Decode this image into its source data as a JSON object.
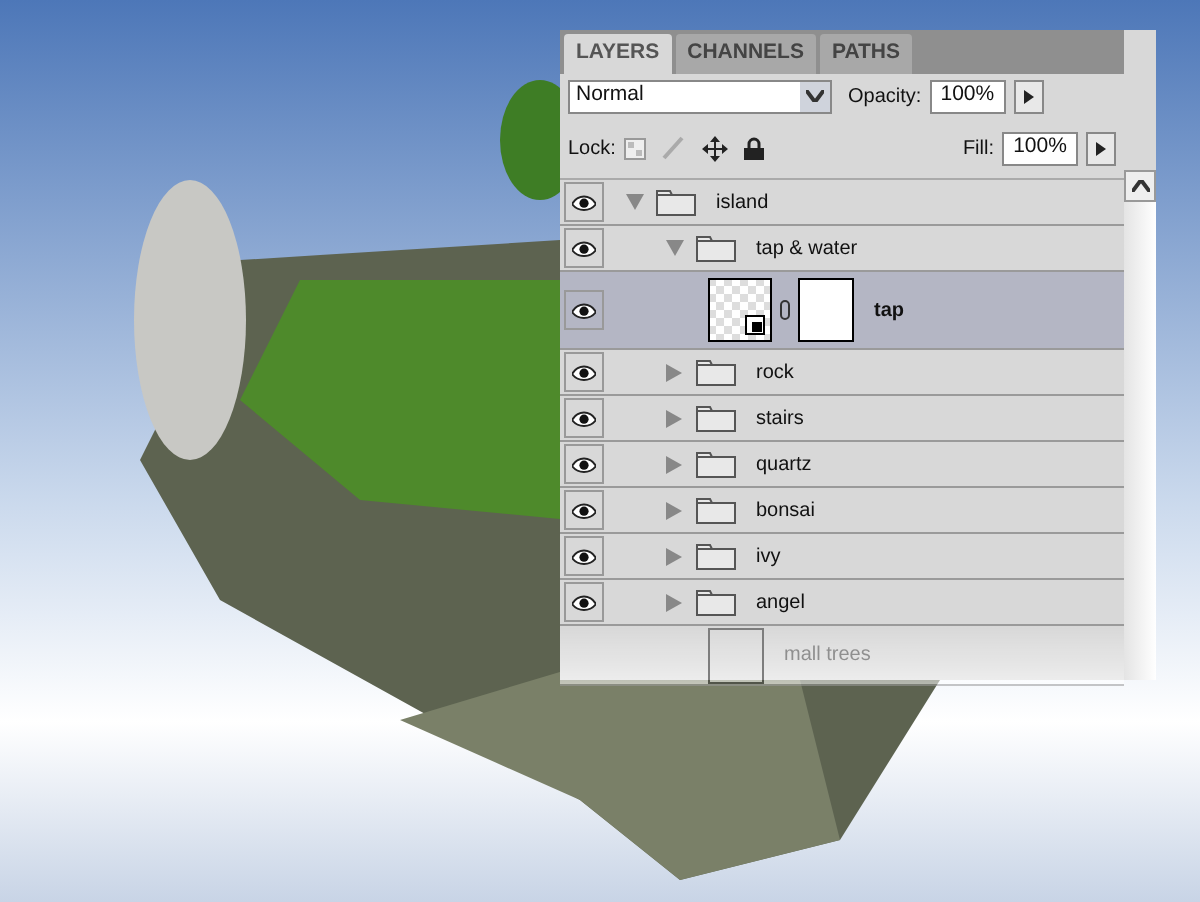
{
  "layers_panel": {
    "tabs": [
      {
        "label": "LAYERS",
        "selected": true
      },
      {
        "label": "CHANNELS",
        "selected": false
      },
      {
        "label": "PATHS",
        "selected": false
      }
    ],
    "blend_mode": {
      "value": "Normal"
    },
    "opacity": {
      "label": "Opacity:",
      "value": "100%"
    },
    "lock": {
      "label": "Lock:"
    },
    "fill": {
      "label": "Fill:",
      "value": "100%"
    },
    "layers": [
      {
        "name": "island",
        "kind": "group",
        "visible": true,
        "expanded": true,
        "selected": false,
        "children": [
          {
            "name": "tap & water",
            "kind": "group",
            "visible": true,
            "expanded": true,
            "selected": false,
            "children": [
              {
                "name": "tap",
                "kind": "layer",
                "visible": true,
                "selected": true
              }
            ]
          },
          {
            "name": "rock",
            "kind": "group",
            "visible": true,
            "expanded": false,
            "selected": false
          },
          {
            "name": "stairs",
            "kind": "group",
            "visible": true,
            "expanded": false,
            "selected": false
          },
          {
            "name": "quartz",
            "kind": "group",
            "visible": true,
            "expanded": false,
            "selected": false
          },
          {
            "name": "bonsai",
            "kind": "group",
            "visible": true,
            "expanded": false,
            "selected": false
          },
          {
            "name": "ivy",
            "kind": "group",
            "visible": true,
            "expanded": false,
            "selected": false
          },
          {
            "name": "angel",
            "kind": "group",
            "visible": true,
            "expanded": false,
            "selected": false
          },
          {
            "name": "mall trees",
            "kind": "layer",
            "visible": false,
            "selected": false,
            "faded": true
          }
        ]
      }
    ]
  }
}
